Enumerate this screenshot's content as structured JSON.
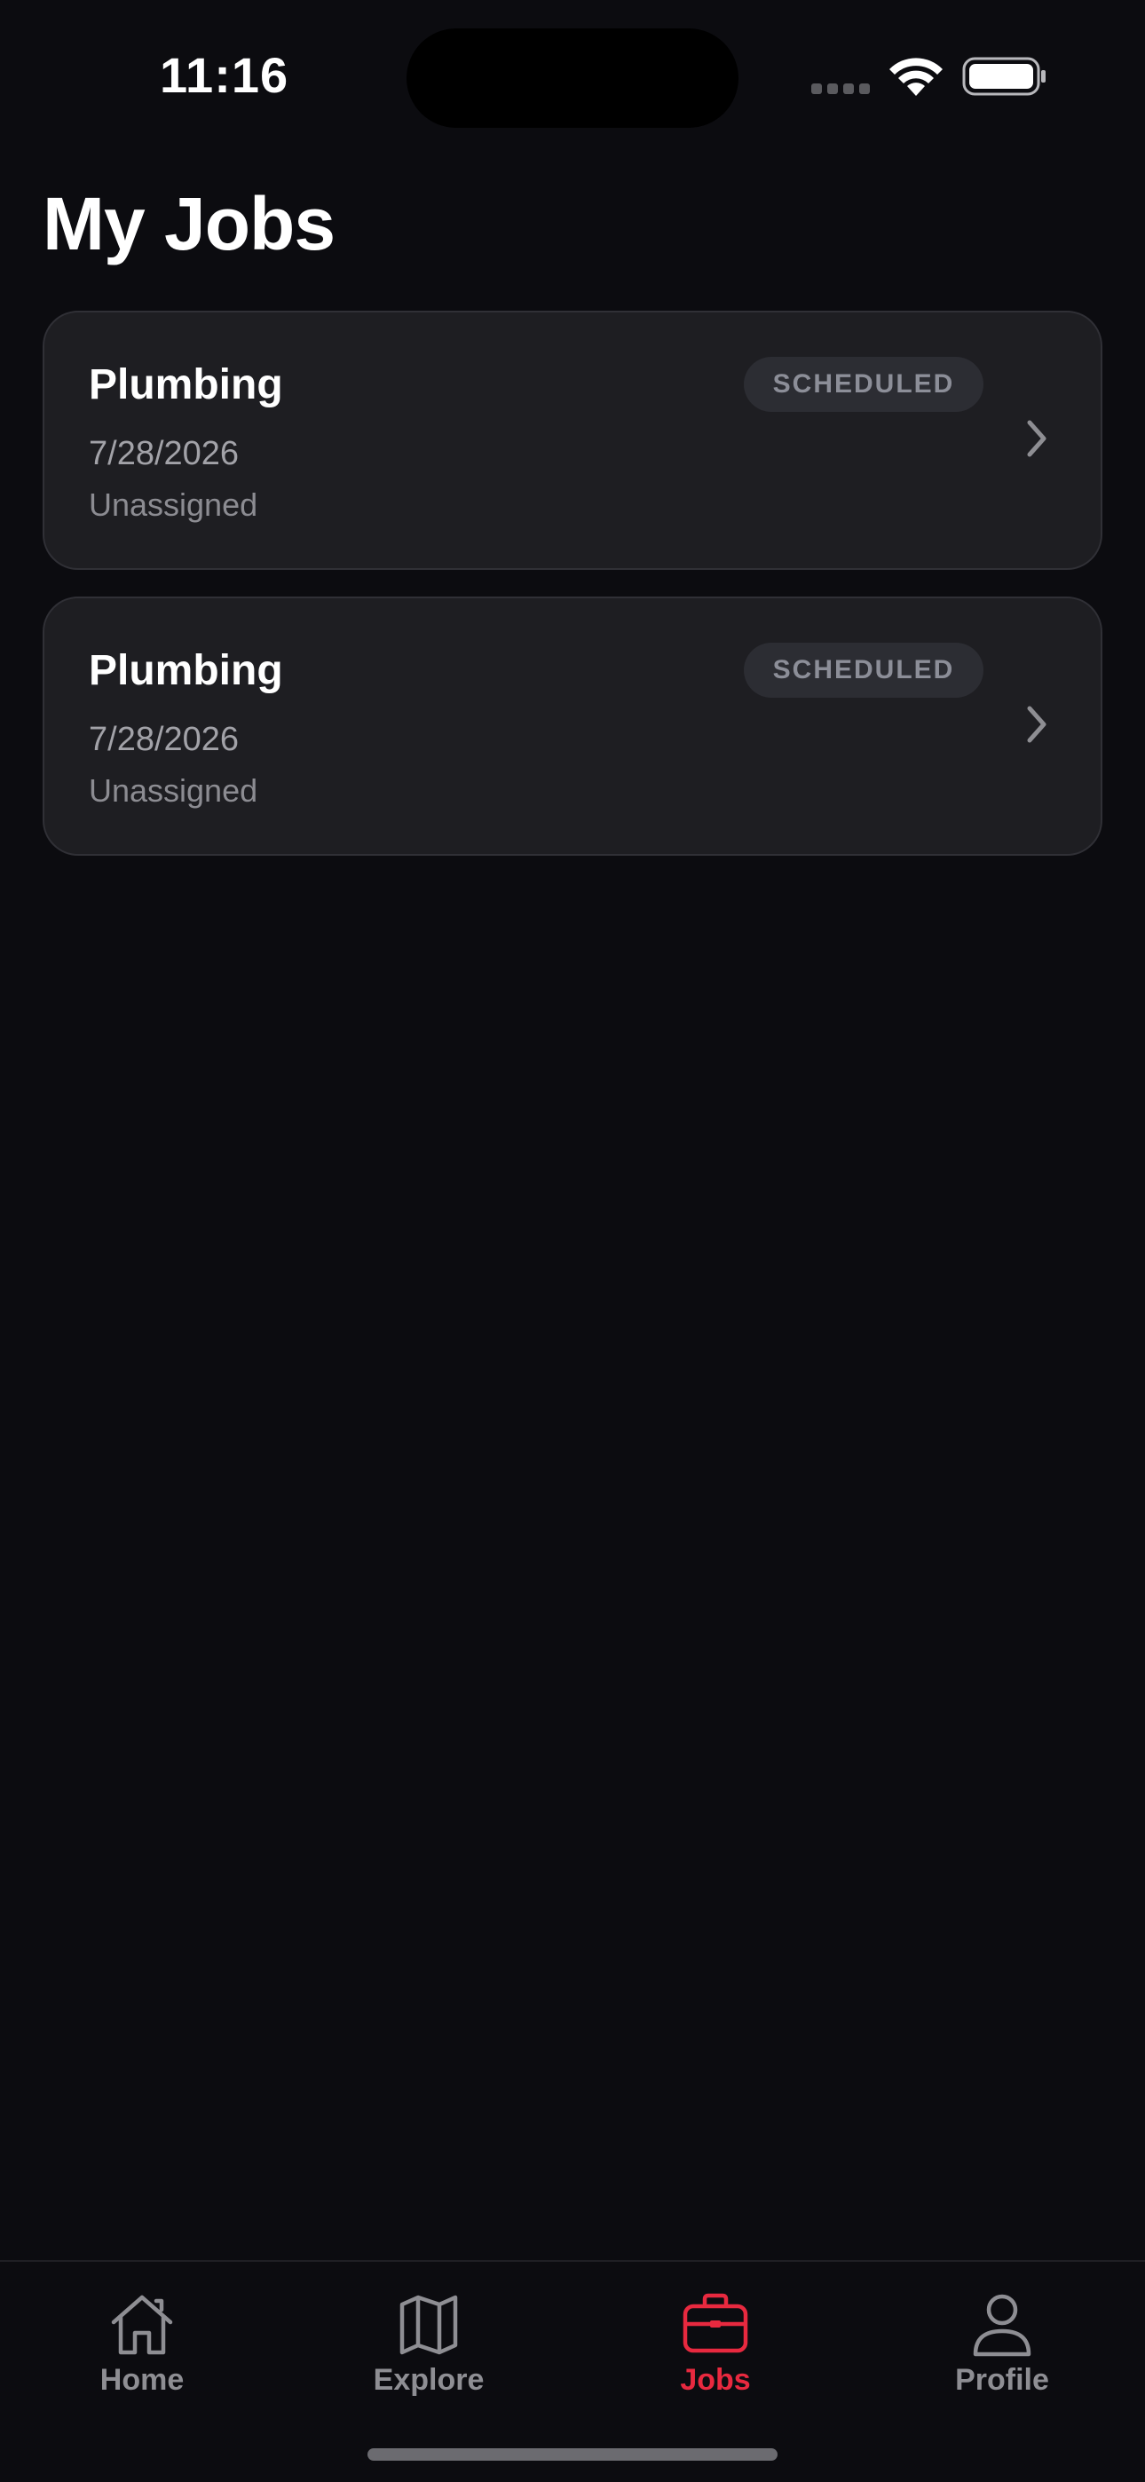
{
  "status_bar": {
    "time": "11:16"
  },
  "page": {
    "title": "My Jobs"
  },
  "jobs": [
    {
      "title": "Plumbing",
      "date": "7/28/2026",
      "assignee": "Unassigned",
      "status": "SCHEDULED"
    },
    {
      "title": "Plumbing",
      "date": "7/28/2026",
      "assignee": "Unassigned",
      "status": "SCHEDULED"
    }
  ],
  "tab_bar": {
    "tabs": [
      {
        "label": "Home",
        "icon": "home-icon",
        "active": false
      },
      {
        "label": "Explore",
        "icon": "map-icon",
        "active": false
      },
      {
        "label": "Jobs",
        "icon": "briefcase-icon",
        "active": true
      },
      {
        "label": "Profile",
        "icon": "person-icon",
        "active": false
      }
    ]
  },
  "colors": {
    "background": "#0c0c10",
    "card": "#1e1e22",
    "accent": "#e8293f",
    "inactive": "#8e8e93"
  }
}
